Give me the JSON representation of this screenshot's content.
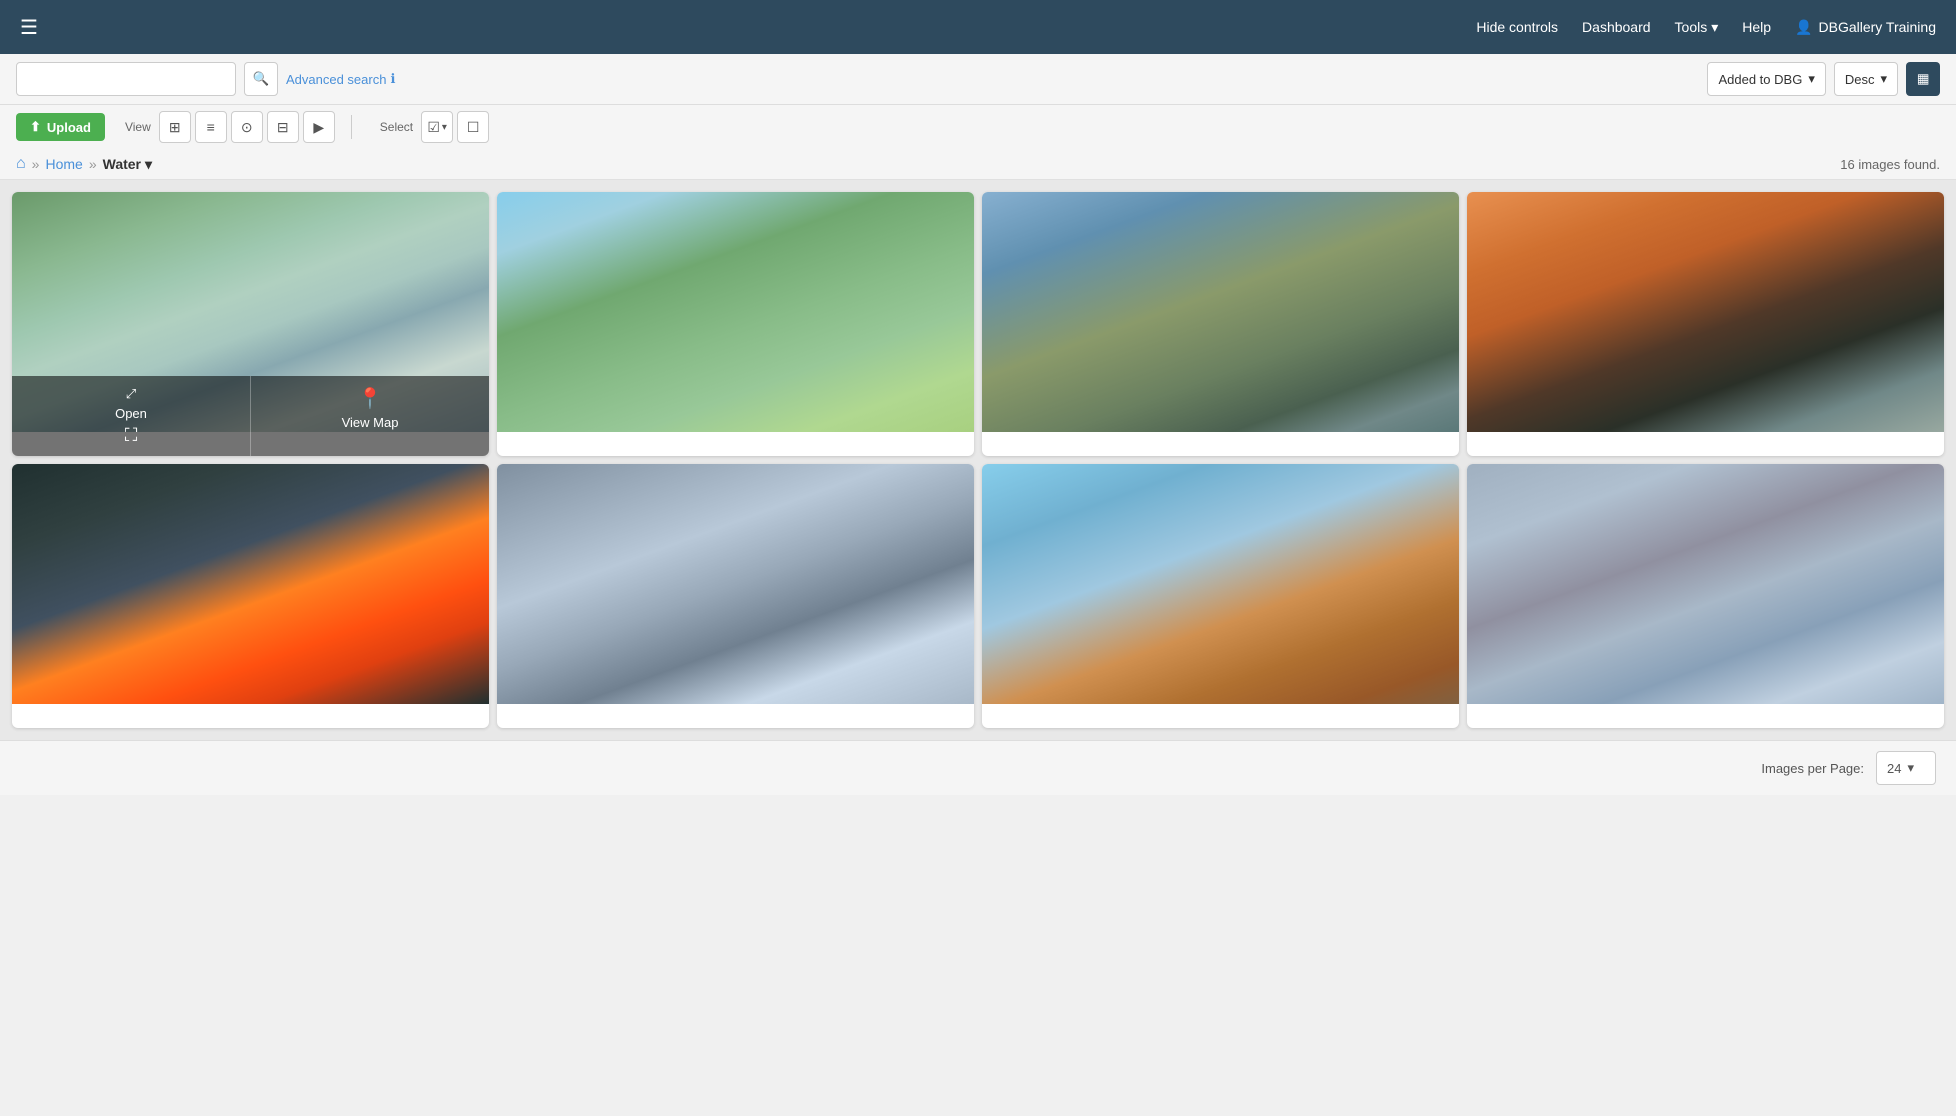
{
  "header": {
    "menu_icon": "☰",
    "hide_controls": "Hide controls",
    "dashboard": "Dashboard",
    "tools": "Tools",
    "tools_arrow": "▾",
    "help": "Help",
    "user_icon": "👤",
    "user_name": "DBGallery Training"
  },
  "search": {
    "placeholder": "",
    "advanced_label": "Advanced search",
    "info_icon": "ℹ"
  },
  "sort": {
    "sort_by": "Added to DBG",
    "order": "Desc",
    "view_icon": "▦"
  },
  "controls": {
    "upload_label": "Upload",
    "view_label": "View",
    "select_label": "Select"
  },
  "breadcrumb": {
    "home_icon": "⌂",
    "sep1": "»",
    "home_text": "Home",
    "sep2": "»",
    "current": "Water",
    "dropdown_icon": "▾",
    "images_count": "16 images found."
  },
  "gallery": {
    "items": [
      {
        "id": 1,
        "color_class": "img-1",
        "has_overlay": true
      },
      {
        "id": 2,
        "color_class": "img-2",
        "has_overlay": false
      },
      {
        "id": 3,
        "color_class": "img-3",
        "has_overlay": false
      },
      {
        "id": 4,
        "color_class": "img-4",
        "has_overlay": false
      },
      {
        "id": 5,
        "color_class": "img-5",
        "has_overlay": false
      },
      {
        "id": 6,
        "color_class": "img-6",
        "has_overlay": false
      },
      {
        "id": 7,
        "color_class": "img-7",
        "has_overlay": false
      },
      {
        "id": 8,
        "color_class": "img-8",
        "has_overlay": false
      }
    ],
    "overlay": {
      "open_label": "Open",
      "open_icon": "⤢",
      "view_map_label": "View Map",
      "view_map_icon": "📍"
    }
  },
  "footer": {
    "per_page_label": "Images per Page:",
    "per_page_value": "24",
    "per_page_arrow": "▾"
  }
}
